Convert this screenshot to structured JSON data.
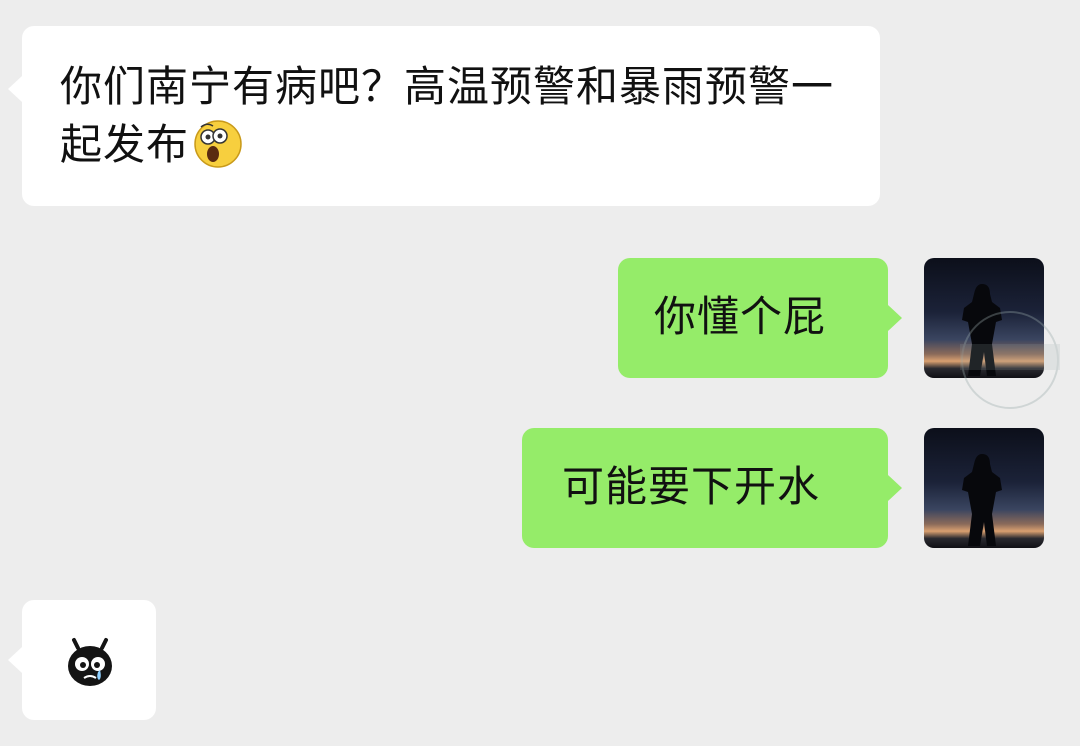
{
  "messages": [
    {
      "text": "你们南宁有病吧？高温预警和暴雨预警一起发布",
      "emoji": "shocked-face-emoji"
    },
    {
      "text": "你懂个屁"
    },
    {
      "text": "可能要下开水"
    },
    {
      "emoji": "crying-blob-emoji"
    }
  ],
  "colors": {
    "background": "#ededed",
    "incoming_bubble": "#ffffff",
    "outgoing_bubble": "#95ec69"
  }
}
